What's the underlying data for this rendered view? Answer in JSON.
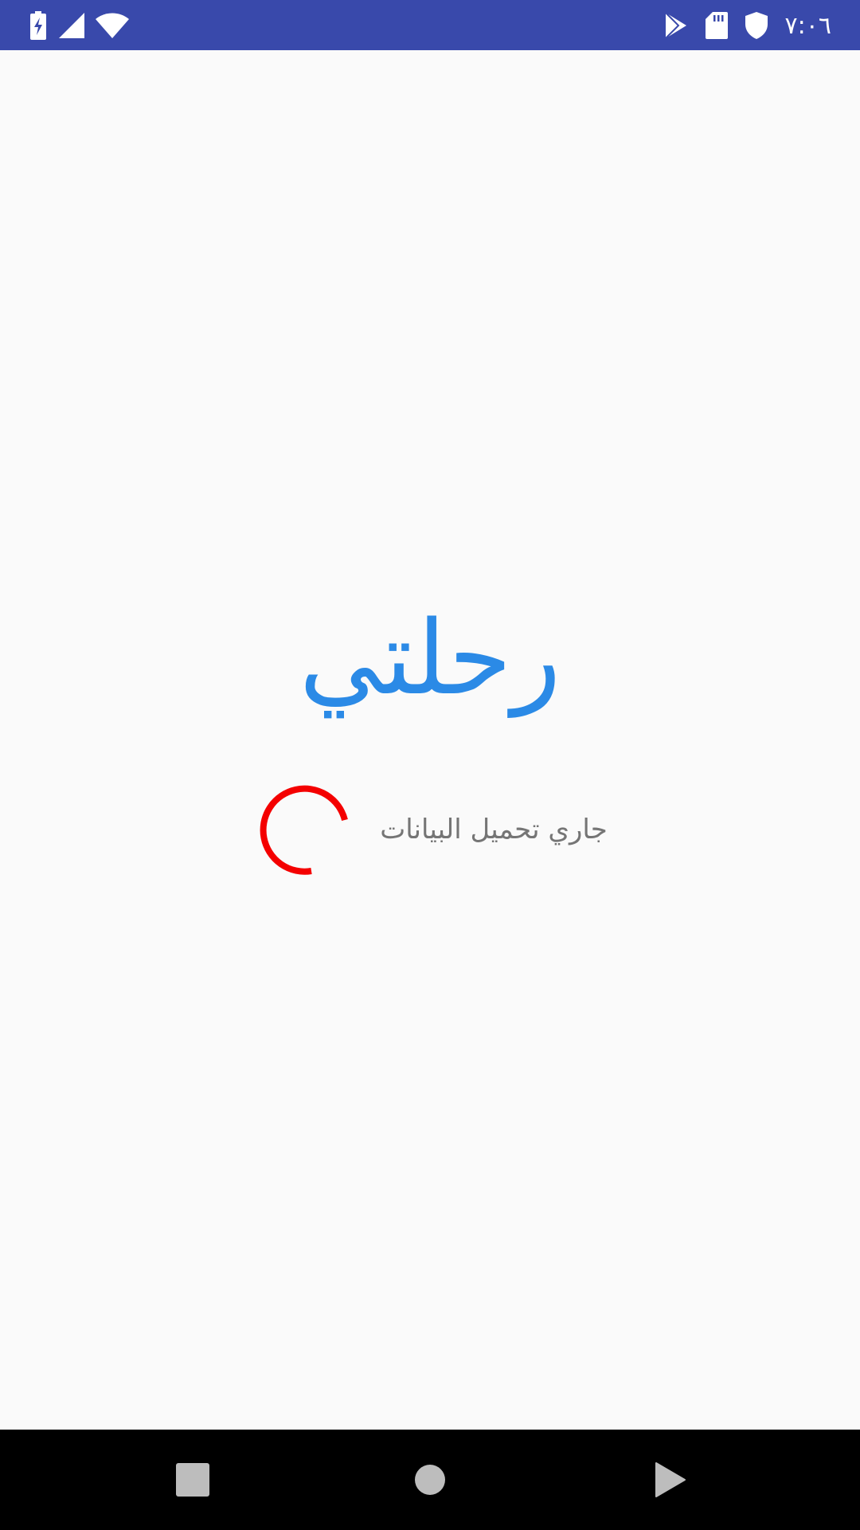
{
  "status_bar": {
    "time": "٧:٠٦",
    "background_color": "#3949ab",
    "left_icons": [
      "battery-charging-icon",
      "signal-icon",
      "wifi-icon"
    ],
    "right_icons": [
      "play-store-icon",
      "sd-card-icon",
      "shield-icon"
    ]
  },
  "splash": {
    "app_title": "رحلتي",
    "title_color": "#2b8ae6",
    "loading_text": "جاري تحميل البيانات",
    "spinner_color": "#f40000"
  },
  "nav_bar": {
    "buttons": [
      "recents-button",
      "home-button",
      "back-button"
    ]
  }
}
